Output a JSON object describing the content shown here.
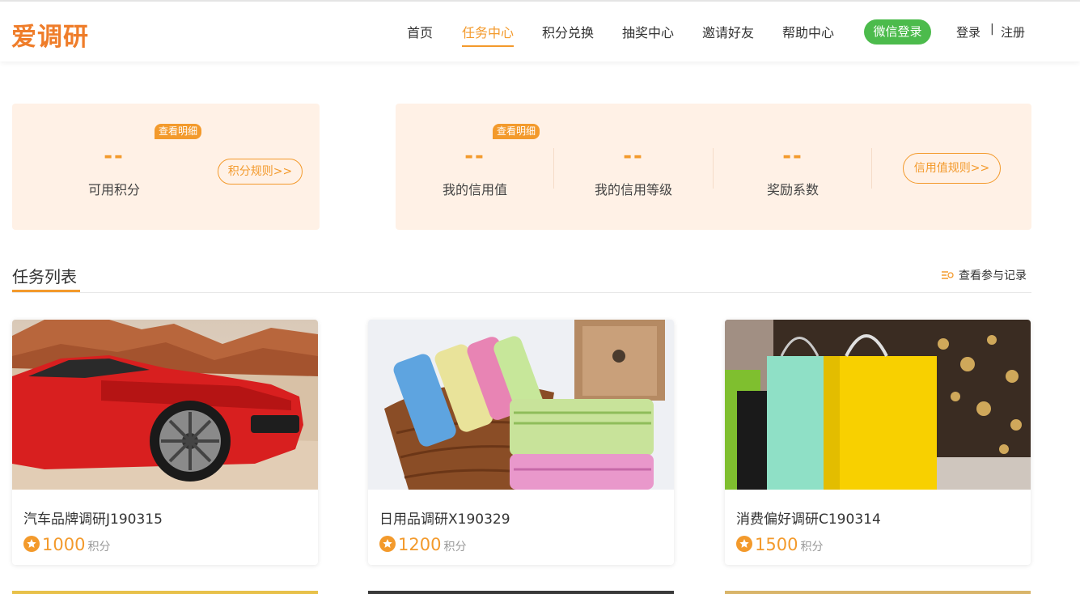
{
  "header": {
    "logo": "爱调研",
    "nav": [
      {
        "label": "首页"
      },
      {
        "label": "任务中心",
        "active": true
      },
      {
        "label": "积分兑换"
      },
      {
        "label": "抽奖中心"
      },
      {
        "label": "邀请好友"
      },
      {
        "label": "帮助中心"
      }
    ],
    "wechat_login": "微信登录",
    "login": "登录",
    "separator": "|",
    "register": "注册"
  },
  "points_panel": {
    "badge": "查看明细",
    "value": "--",
    "label": "可用积分",
    "rule_button": "积分规则>>"
  },
  "credit_panel": {
    "badge": "查看明细",
    "stats": [
      {
        "value": "--",
        "label": "我的信用值"
      },
      {
        "value": "--",
        "label": "我的信用等级"
      },
      {
        "value": "--",
        "label": "奖励系数"
      }
    ],
    "rule_button": "信用值规则>>"
  },
  "task_section": {
    "title": "任务列表",
    "records_link": "查看参与记录"
  },
  "tasks": [
    {
      "title": "汽车品牌调研J190315",
      "points": "1000",
      "unit": "积分",
      "image": "red-sports-car-desert"
    },
    {
      "title": "日用品调研X190329",
      "points": "1200",
      "unit": "积分",
      "image": "towels-in-basket"
    },
    {
      "title": "消费偏好调研C190314",
      "points": "1500",
      "unit": "积分",
      "image": "shopping-bags-bokeh"
    }
  ],
  "colors": {
    "accent": "#f39a2c",
    "logo": "#ef7d2a",
    "panel_bg": "#fff1e6",
    "wechat_green": "#4cbb4c"
  }
}
